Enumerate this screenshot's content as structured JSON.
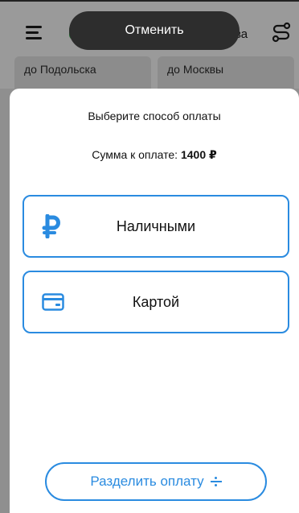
{
  "toast": {
    "label": "Отменить"
  },
  "topbar": {
    "city_partial": "ва"
  },
  "destinations": [
    {
      "label": "до Подольска"
    },
    {
      "label": "до Москвы"
    }
  ],
  "sheet": {
    "title": "Выберите способ оплаты",
    "sum_label": "Сумма к оплате:",
    "sum_value": "1400 ₽",
    "options": [
      {
        "label": "Наличными",
        "icon": "ruble-icon"
      },
      {
        "label": "Картой",
        "icon": "credit-card-icon"
      }
    ],
    "split_label": "Разделить оплату",
    "split_icon": "divide-icon"
  },
  "colors": {
    "accent": "#2a8be0",
    "toast_bg": "#2d2d2d"
  }
}
